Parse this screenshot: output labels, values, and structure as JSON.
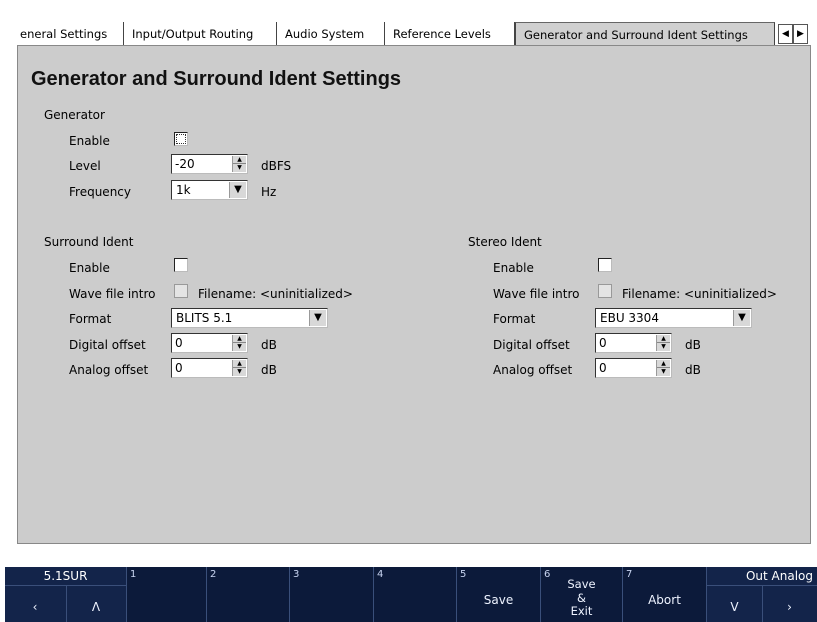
{
  "tabs": [
    {
      "label": "eneral Settings",
      "active": false
    },
    {
      "label": "Input/Output Routing",
      "active": false
    },
    {
      "label": "Audio System",
      "active": false
    },
    {
      "label": "Reference Levels",
      "active": false
    },
    {
      "label": "Generator and Surround Ident Settings",
      "active": true
    }
  ],
  "tab_scroll": {
    "left_icon": "arrow-left-icon",
    "right_icon": "arrow-right-icon",
    "left_glyph": "◀",
    "right_glyph": "▶"
  },
  "page_title": "Generator and Surround Ident Settings",
  "generator": {
    "heading": "Generator",
    "enable_label": "Enable",
    "enable_checked": false,
    "level_label": "Level",
    "level_value": "-20",
    "level_unit": "dBFS",
    "frequency_label": "Frequency",
    "frequency_value": "1k",
    "frequency_unit": "Hz"
  },
  "surround_ident": {
    "heading": "Surround Ident",
    "enable_label": "Enable",
    "enable_checked": false,
    "wave_intro_label": "Wave file intro",
    "wave_intro_checked": false,
    "filename_text": "Filename: <uninitialized>",
    "format_label": "Format",
    "format_value": "BLITS 5.1",
    "digital_offset_label": "Digital offset",
    "digital_offset_value": "0",
    "digital_offset_unit": "dB",
    "analog_offset_label": "Analog offset",
    "analog_offset_value": "0",
    "analog_offset_unit": "dB"
  },
  "stereo_ident": {
    "heading": "Stereo Ident",
    "enable_label": "Enable",
    "enable_checked": false,
    "wave_intro_label": "Wave file intro",
    "wave_intro_checked": false,
    "filename_text": "Filename: <uninitialized>",
    "format_label": "Format",
    "format_value": "EBU 3304",
    "digital_offset_label": "Digital offset",
    "digital_offset_value": "0",
    "digital_offset_unit": "dB",
    "analog_offset_label": "Analog offset",
    "analog_offset_value": "0",
    "analog_offset_unit": "dB"
  },
  "glyphs": {
    "spin_up": "▲",
    "spin_down": "▼",
    "dropdown": "▼"
  },
  "softkeys": {
    "k0": {
      "top": "5.1SUR",
      "left_arrow": "‹",
      "up_arrow": "Λ"
    },
    "k1": {
      "num": "1"
    },
    "k2": {
      "num": "2"
    },
    "k3": {
      "num": "3"
    },
    "k4": {
      "num": "4"
    },
    "k5": {
      "num": "5",
      "label": "Save"
    },
    "k6": {
      "num": "6",
      "label_lines": [
        "Save",
        "&",
        "Exit"
      ]
    },
    "k7": {
      "num": "7",
      "label": "Abort"
    },
    "k8": {
      "top": "Out Analog",
      "down_arrow": "V",
      "right_arrow": "›"
    }
  },
  "colors": {
    "panel": "#cccccc",
    "softbar": "#0c1a3a",
    "softbar_text": "#eef3ff"
  }
}
